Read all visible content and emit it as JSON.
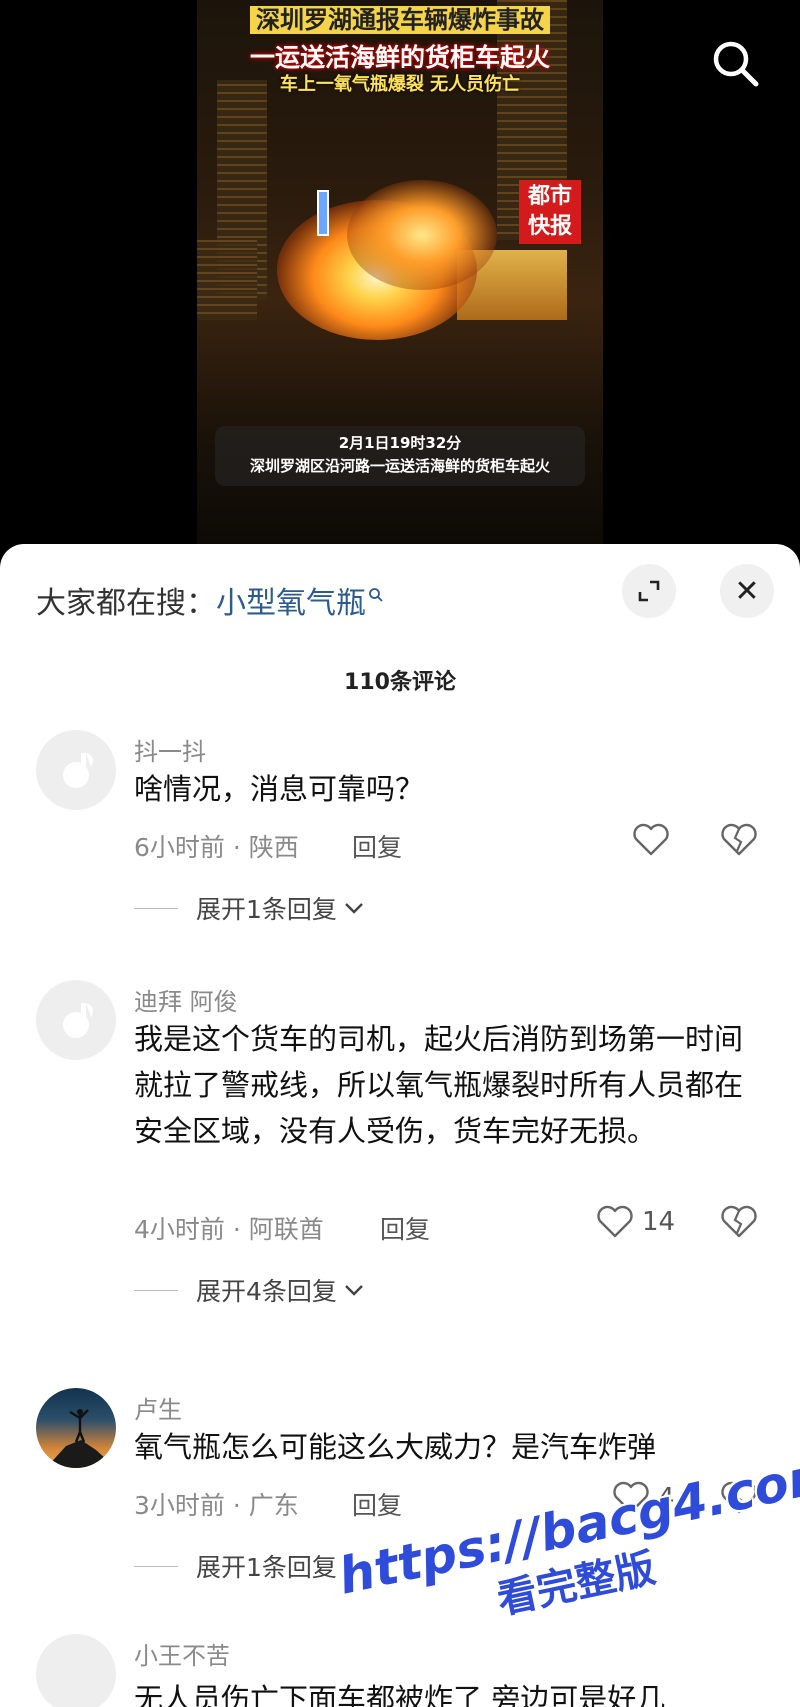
{
  "video": {
    "headline_top": "深圳罗湖通报车辆爆炸事故",
    "headline_main": "一运送活海鲜的货柜车起火",
    "headline_sub": "车上一氧气瓶爆裂 无人员伤亡",
    "logo_text": [
      "都市",
      "快报"
    ],
    "caption_time": "2月1日19时32分",
    "caption_text": "深圳罗湖区沿河路一运送活海鲜的货柜车起火",
    "search_icon": "search-icon"
  },
  "sheet": {
    "trending_label": "大家都在搜：",
    "trending_keyword": "小型氧气瓶",
    "comment_count": "110条评论",
    "icons": {
      "expand": "expand-icon",
      "close": "close-icon"
    },
    "close_glyph": "✕"
  },
  "comments": [
    {
      "username": "抖一抖",
      "text": "啥情况，消息可靠吗？",
      "meta": "6小时前 · 陕西",
      "reply_label": "回复",
      "likes": "",
      "expand_label": "展开1条回复"
    },
    {
      "username": "迪拜 阿俊",
      "text": "我是这个货车的司机，起火后消防到场第一时间就拉了警戒线，所以氧气瓶爆裂时所有人员都在安全区域，没有人受伤，货车完好无损。",
      "meta": "4小时前 · 阿联酋",
      "reply_label": "回复",
      "likes": "14",
      "expand_label": "展开4条回复"
    },
    {
      "username": "卢生",
      "text": "氧气瓶怎么可能这么大威力？是汽车炸弹",
      "meta": "3小时前 · 广东",
      "reply_label": "回复",
      "likes": "4",
      "expand_label": "展开1条回复"
    },
    {
      "username": "小王不苦",
      "text": "无人员伤亡下面车都被炸了 旁边可是好几"
    }
  ],
  "watermark": {
    "line1": "https://bacg4.com",
    "line2": "看完整版"
  },
  "colors": {
    "keyword": "#2c5b8f",
    "watermark": "#2e4bd9",
    "sheet_bg": "#ffffff"
  }
}
